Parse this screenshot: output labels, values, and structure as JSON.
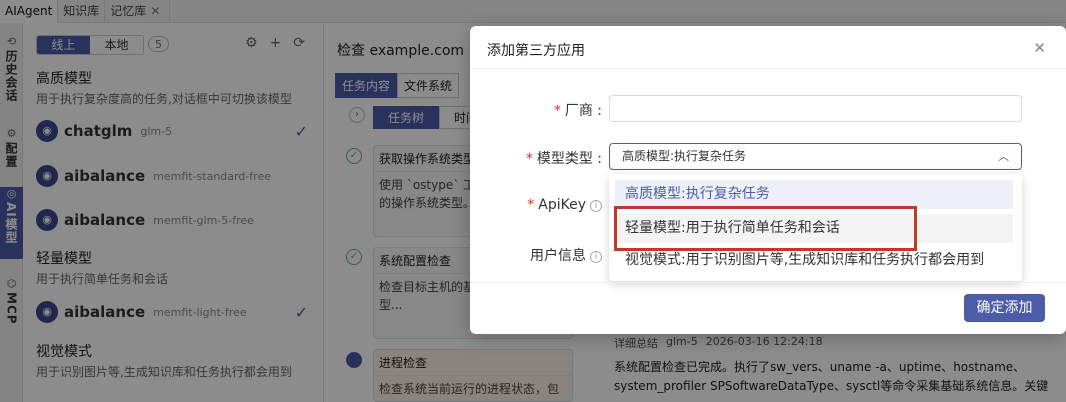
{
  "top_tabs": [
    {
      "label": "AIAgent"
    },
    {
      "label": "知识库"
    },
    {
      "label": "记忆库"
    }
  ],
  "sidebar_nav": [
    {
      "label": "历史会话",
      "icon": "history-icon"
    },
    {
      "label": "配置",
      "icon": "gear-icon"
    },
    {
      "label": "AI模型",
      "icon": "model-icon"
    },
    {
      "label": "MCP",
      "icon": "mcp-icon"
    }
  ],
  "model_panel": {
    "seg_online": "线上",
    "seg_local": "本地",
    "count": "5",
    "groups": [
      {
        "title": "高质模型",
        "desc": "用于执行复杂度高的任务,对话框中可切换该模型"
      },
      {
        "title": "轻量模型",
        "desc": "用于执行简单任务和会话"
      },
      {
        "title": "视觉模式",
        "desc": "用于识别图片等,生成知识库和任务执行都会用到"
      }
    ],
    "models": [
      {
        "name": "chatglm",
        "tag": "glm-5"
      },
      {
        "name": "aibalance",
        "tag": "memfit-standard-free"
      },
      {
        "name": "aibalance",
        "tag": "memfit-glm-5-free"
      },
      {
        "name": "aibalance",
        "tag": "memfit-light-free"
      }
    ]
  },
  "task_panel": {
    "title": "检查 example.com",
    "tabs": [
      "任务内容",
      "文件系统"
    ],
    "subtabs": [
      "任务树",
      "时间"
    ],
    "cards": [
      {
        "title": "获取操作系统类型",
        "body": "使用 `ostype` 工具获取目标主机的操作系统类型。"
      },
      {
        "title": "系统配置检查",
        "body": "检查目标主机的基础操作系统类型..."
      },
      {
        "title": "进程检查",
        "body": "检查系统当前运行的进程状态，包"
      }
    ]
  },
  "right_panel": {
    "summary_label": "详细总结",
    "model_tag": "glm-5",
    "timestamp": "2026-03-16 12:24:18",
    "text": "系统配置检查已完成。执行了sw_vers、uname -a、uptime、hostname、system_profiler SPSoftwareDataType、sysctl等命令采集基础系统信息。关键"
  },
  "modal": {
    "title": "添加第三方应用",
    "fields": {
      "vendor_label": "厂商 :",
      "vendor_value": "",
      "model_type_label": "模型类型 :",
      "model_type_value": "高质模型:执行复杂任务",
      "apikey_label": "ApiKey",
      "userinfo_label": "用户信息"
    },
    "options": [
      "高质模型:执行复杂任务",
      "轻量模型:用于执行简单任务和会话",
      "视觉模式:用于识别图片等,生成知识库和任务执行都会用到"
    ],
    "confirm_label": "确定添加"
  },
  "colors": {
    "accent": "#4c5ca8",
    "highlight_border": "#c0392b",
    "required": "#e0302a"
  }
}
